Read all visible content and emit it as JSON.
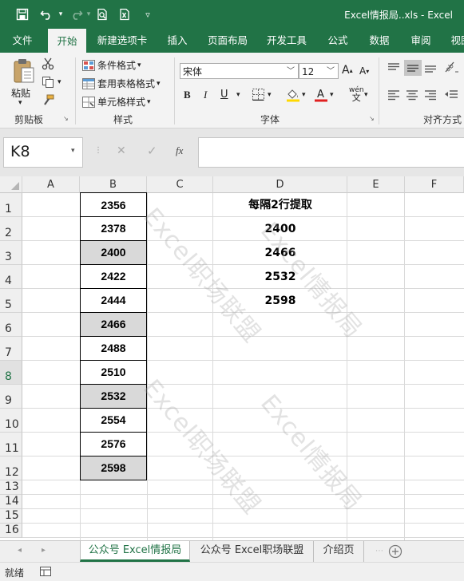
{
  "window": {
    "title": "Excel情报局..xls  -  Excel"
  },
  "ribbon_tabs": [
    "文件",
    "开始",
    "新建选项卡",
    "插入",
    "页面布局",
    "开发工具",
    "公式",
    "数据",
    "审阅",
    "视图"
  ],
  "active_tab": "开始",
  "ribbon": {
    "clipboard": {
      "paste_label": "粘贴",
      "group_label": "剪贴板"
    },
    "styles": {
      "conditional": "条件格式",
      "table": "套用表格格式",
      "cell": "单元格样式",
      "group_label": "样式"
    },
    "font": {
      "name": "宋体",
      "size": "12",
      "bold": "B",
      "italic": "I",
      "underline": "U",
      "phonetic": "wén",
      "group_label": "字体"
    },
    "align": {
      "group_label": "对齐方式"
    }
  },
  "formula_bar": {
    "name_box": "K8",
    "fx": "fx",
    "formula": ""
  },
  "columns": [
    "A",
    "B",
    "C",
    "D",
    "E",
    "F"
  ],
  "rows": [
    "1",
    "2",
    "3",
    "4",
    "5",
    "6",
    "7",
    "8",
    "9",
    "10",
    "11",
    "12",
    "13",
    "14",
    "15",
    "16"
  ],
  "selected_row": "8",
  "column_b": [
    {
      "value": "2356",
      "shaded": false
    },
    {
      "value": "2378",
      "shaded": false
    },
    {
      "value": "2400",
      "shaded": true
    },
    {
      "value": "2422",
      "shaded": false
    },
    {
      "value": "2444",
      "shaded": false
    },
    {
      "value": "2466",
      "shaded": true
    },
    {
      "value": "2488",
      "shaded": false
    },
    {
      "value": "2510",
      "shaded": false
    },
    {
      "value": "2532",
      "shaded": true
    },
    {
      "value": "2554",
      "shaded": false
    },
    {
      "value": "2576",
      "shaded": false
    },
    {
      "value": "2598",
      "shaded": true
    }
  ],
  "column_d": [
    "每隔2行提取",
    "2400",
    "2466",
    "2532",
    "2598"
  ],
  "watermarks": [
    "Excel职场联盟",
    "Excel情报局",
    "Excel职场联盟",
    "Excel情报局"
  ],
  "sheet_tabs": [
    "公众号 Excel情报局",
    "公众号 Excel职场联盟",
    "介绍页"
  ],
  "active_sheet": "公众号 Excel情报局",
  "status": {
    "text": "就绪"
  },
  "colors": {
    "accent": "#217346",
    "shaded_cell": "#d9d9d9"
  }
}
